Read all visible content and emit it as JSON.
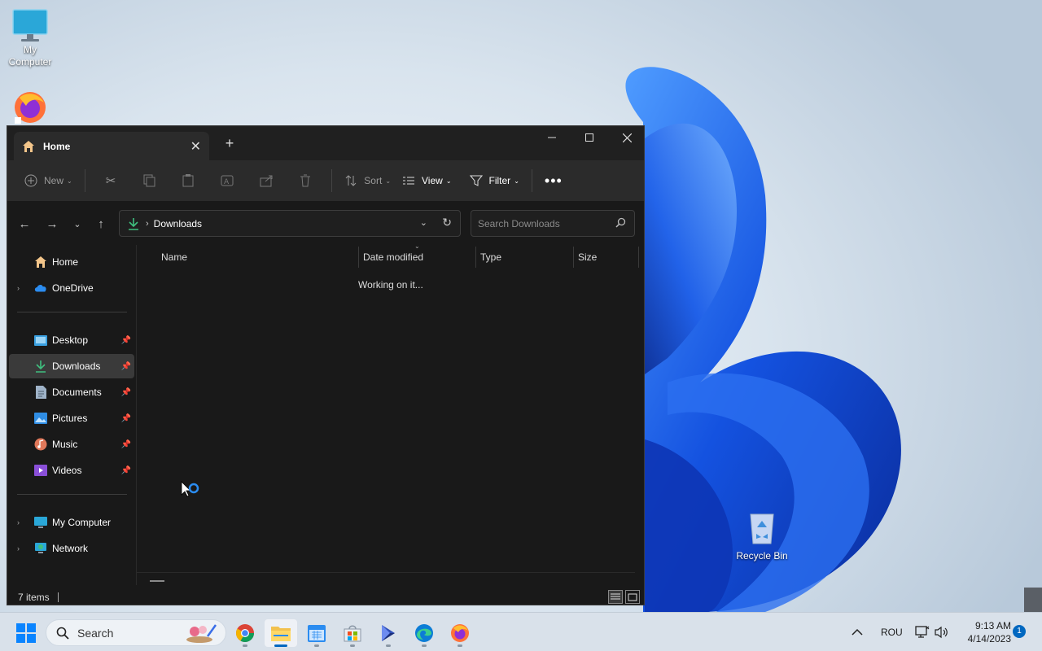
{
  "desktop": {
    "icons": [
      {
        "label": "My\nComputer"
      },
      {
        "label": "Recycle Bin"
      }
    ]
  },
  "explorer": {
    "tab_title": "Home",
    "toolbar": {
      "new_label": "New",
      "sort_label": "Sort",
      "view_label": "View",
      "filter_label": "Filter"
    },
    "address": {
      "current_folder": "Downloads"
    },
    "search": {
      "placeholder": "Search Downloads"
    },
    "sidebar": {
      "items": [
        {
          "label": "Home",
          "icon": "home-icon"
        },
        {
          "label": "OneDrive",
          "icon": "cloud-icon"
        },
        {
          "label": "Desktop",
          "icon": "desktop-folder-icon"
        },
        {
          "label": "Downloads",
          "icon": "download-icon"
        },
        {
          "label": "Documents",
          "icon": "document-icon"
        },
        {
          "label": "Pictures",
          "icon": "picture-icon"
        },
        {
          "label": "Music",
          "icon": "music-icon"
        },
        {
          "label": "Videos",
          "icon": "video-icon"
        },
        {
          "label": "My Computer",
          "icon": "computer-icon"
        },
        {
          "label": "Network",
          "icon": "network-icon"
        }
      ]
    },
    "columns": [
      "Name",
      "Date modified",
      "Type",
      "Size"
    ],
    "loading_message": "Working on it...",
    "status": {
      "item_count": "7 items"
    }
  },
  "taskbar": {
    "search_label": "Search",
    "language": "ROU",
    "time": "9:13 AM",
    "date": "4/14/2023",
    "notification_count": "1"
  },
  "colors": {
    "accent": "#0067c0",
    "window_bg": "#191919",
    "toolbar_bg": "#2b2b2b"
  }
}
